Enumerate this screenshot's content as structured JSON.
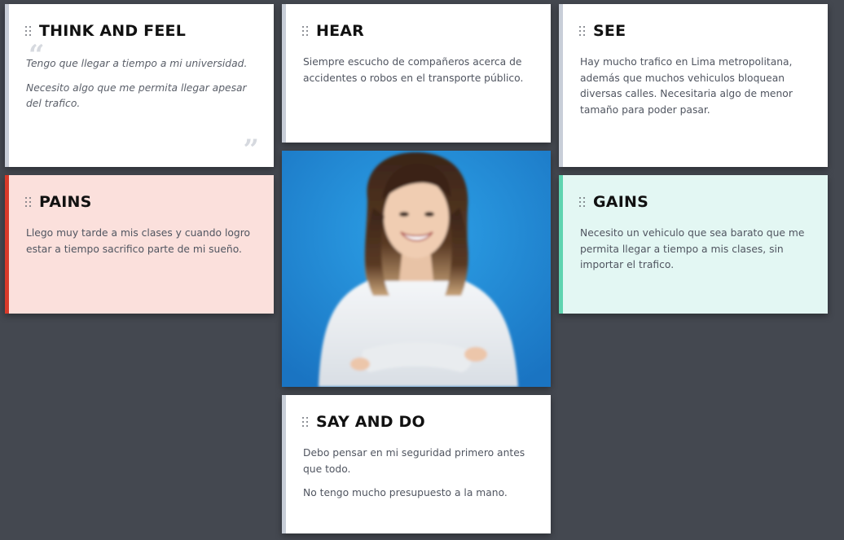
{
  "cards": {
    "think_and_feel": {
      "title": "THINK AND FEEL",
      "lines": [
        "Tengo que llegar a tiempo a mi universidad.",
        "Necesito algo que me permita llegar apesar del trafico."
      ],
      "quote_open": "“",
      "quote_close": "”"
    },
    "hear": {
      "title": "HEAR",
      "lines": [
        "Siempre escucho de compañeros acerca de accidentes o robos en el transporte público."
      ]
    },
    "see": {
      "title": "SEE",
      "lines": [
        "Hay mucho trafico en Lima metropolitana, además que muchos vehiculos bloquean diversas calles. Necesitaria algo de menor tamaño para poder pasar."
      ]
    },
    "pains": {
      "title": "PAINS",
      "lines": [
        "Llego muy tarde a mis clases y cuando logro estar a tiempo sacrifico parte de mi sueño."
      ]
    },
    "gains": {
      "title": "GAINS",
      "lines": [
        "Necesito un vehiculo que sea barato que me permita llegar a tiempo a mis clases, sin importar el trafico."
      ]
    },
    "say_and_do": {
      "title": "SAY AND DO",
      "lines": [
        "Debo pensar en mi seguridad primero antes que todo.",
        "No tengo mucho presupuesto a la mano."
      ]
    }
  },
  "photo": {
    "subject": "persona-photo"
  },
  "colors": {
    "board_background": "#444850",
    "pains_accent": "#d83a2a",
    "gains_accent": "#5fd4b0",
    "default_accent": "#c8ced8"
  }
}
